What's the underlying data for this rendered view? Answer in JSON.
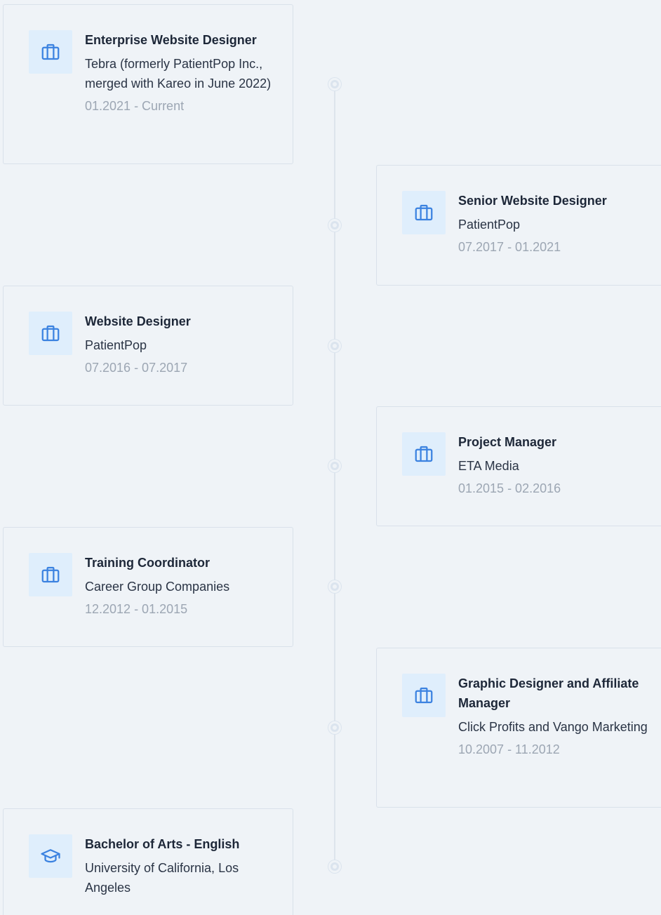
{
  "entries": [
    {
      "type": "work",
      "icon": "briefcase-icon",
      "title": "Enterprise Website Designer",
      "organization": "Tebra (formerly PatientPop Inc., merged with Kareo in June 2022)",
      "dates": "01.2021 - Current"
    },
    {
      "type": "work",
      "icon": "briefcase-icon",
      "title": "Senior Website Designer",
      "organization": "PatientPop",
      "dates": "07.2017 - 01.2021"
    },
    {
      "type": "work",
      "icon": "briefcase-icon",
      "title": "Website Designer",
      "organization": "PatientPop",
      "dates": "07.2016 - 07.2017"
    },
    {
      "type": "work",
      "icon": "briefcase-icon",
      "title": "Project Manager",
      "organization": "ETA Media",
      "dates": "01.2015 - 02.2016"
    },
    {
      "type": "work",
      "icon": "briefcase-icon",
      "title": "Training Coordinator",
      "organization": "Career Group Companies",
      "dates": "12.2012 - 01.2015"
    },
    {
      "type": "work",
      "icon": "briefcase-icon",
      "title": "Graphic Designer and Affiliate Manager",
      "organization": "Click Profits and Vango Marketing",
      "dates": "10.2007 - 11.2012"
    },
    {
      "type": "education",
      "icon": "graduation-cap-icon",
      "title": "Bachelor of Arts - English",
      "organization": "University of California, Los Angeles",
      "dates": ""
    }
  ],
  "colors": {
    "background": "#eff3f7",
    "icon_bg": "#dfeefc",
    "icon_stroke": "#3b82e0",
    "title": "#1d2738",
    "muted": "#9ca6b3",
    "line": "#dde4ec"
  }
}
